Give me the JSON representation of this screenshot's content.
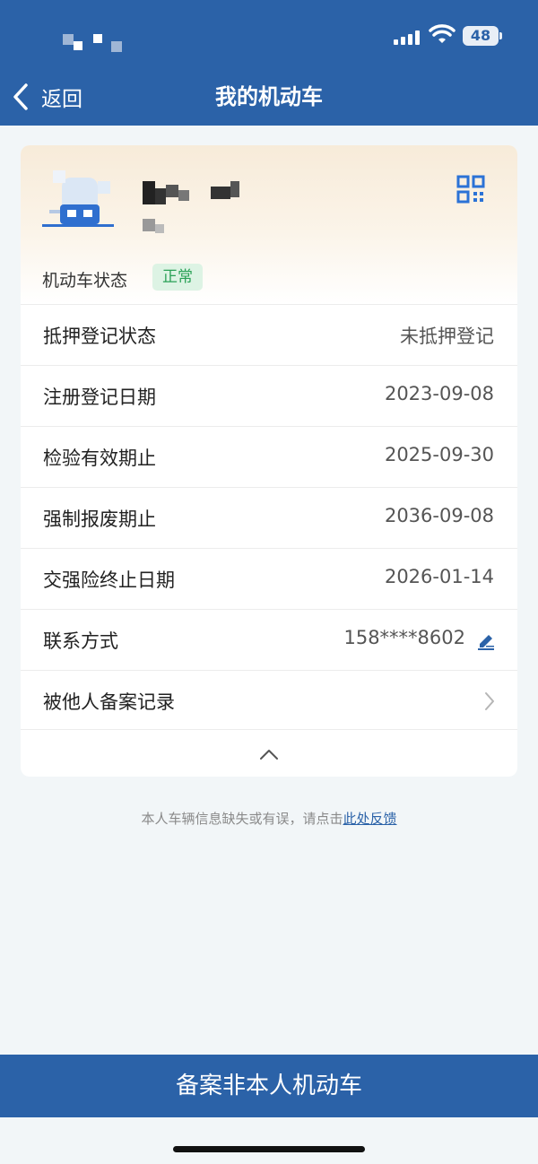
{
  "status_bar": {
    "battery": "48",
    "icons": [
      "signal-icon",
      "wifi-icon",
      "battery-icon"
    ]
  },
  "nav": {
    "back_label": "返回",
    "title": "我的机动车"
  },
  "vehicle": {
    "status_label": "机动车状态",
    "status_value": "正常",
    "rows": [
      {
        "label": "抵押登记状态",
        "value": "未抵押登记"
      },
      {
        "label": "注册登记日期",
        "value": "2023-09-08"
      },
      {
        "label": "检验有效期止",
        "value": "2025-09-30"
      },
      {
        "label": "强制报废期止",
        "value": "2036-09-08"
      },
      {
        "label": "交强险终止日期",
        "value": "2026-01-14"
      },
      {
        "label": "联系方式",
        "value": "158****8602"
      },
      {
        "label": "被他人备案记录",
        "value": ""
      }
    ]
  },
  "feedback": {
    "text": "本人车辆信息缺失或有误，请点击",
    "link": "此处反馈"
  },
  "bottom_button": "备案非本人机动车",
  "colors": {
    "primary": "#2b62a8",
    "status_green": "#2aa156",
    "status_green_bg": "#ddf3e4",
    "page_bg": "#f2f6f8"
  }
}
